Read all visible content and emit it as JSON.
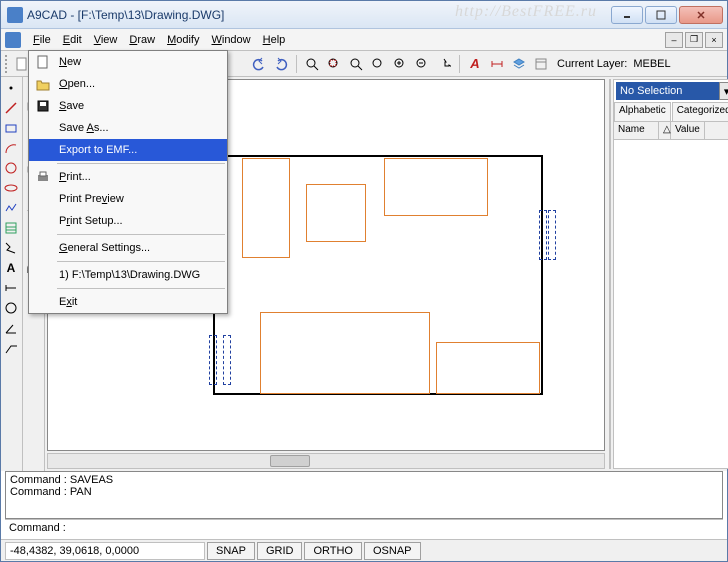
{
  "window": {
    "title": "A9CAD - [F:\\Temp\\13\\Drawing.DWG]",
    "watermark": "http://BestFREE.ru"
  },
  "menubar": {
    "items": [
      "File",
      "Edit",
      "View",
      "Draw",
      "Modify",
      "Window",
      "Help"
    ]
  },
  "file_menu": {
    "new": "New",
    "open": "Open...",
    "save": "Save",
    "save_as": "Save As...",
    "export_emf": "Export to EMF...",
    "print": "Print...",
    "print_preview": "Print Preview",
    "print_setup": "Print Setup...",
    "general_settings": "General Settings...",
    "recent1": "1) F:\\Temp\\13\\Drawing.DWG",
    "exit": "Exit"
  },
  "toolbar": {
    "current_layer_label": "Current Layer:",
    "current_layer_value": "MEBEL"
  },
  "right_panel": {
    "selection": "No Selection",
    "tab_alpha": "Alphabetic",
    "tab_cat": "Categorized",
    "col_name": "Name",
    "col_value": "Value"
  },
  "command_history": {
    "line1": "Command : SAVEAS",
    "line2": "Command : PAN"
  },
  "command_prompt": "Command :",
  "statusbar": {
    "coords": "-48,4382, 39,0618, 0,0000",
    "snap": "SNAP",
    "grid": "GRID",
    "ortho": "ORTHO",
    "osnap": "OSNAP"
  }
}
